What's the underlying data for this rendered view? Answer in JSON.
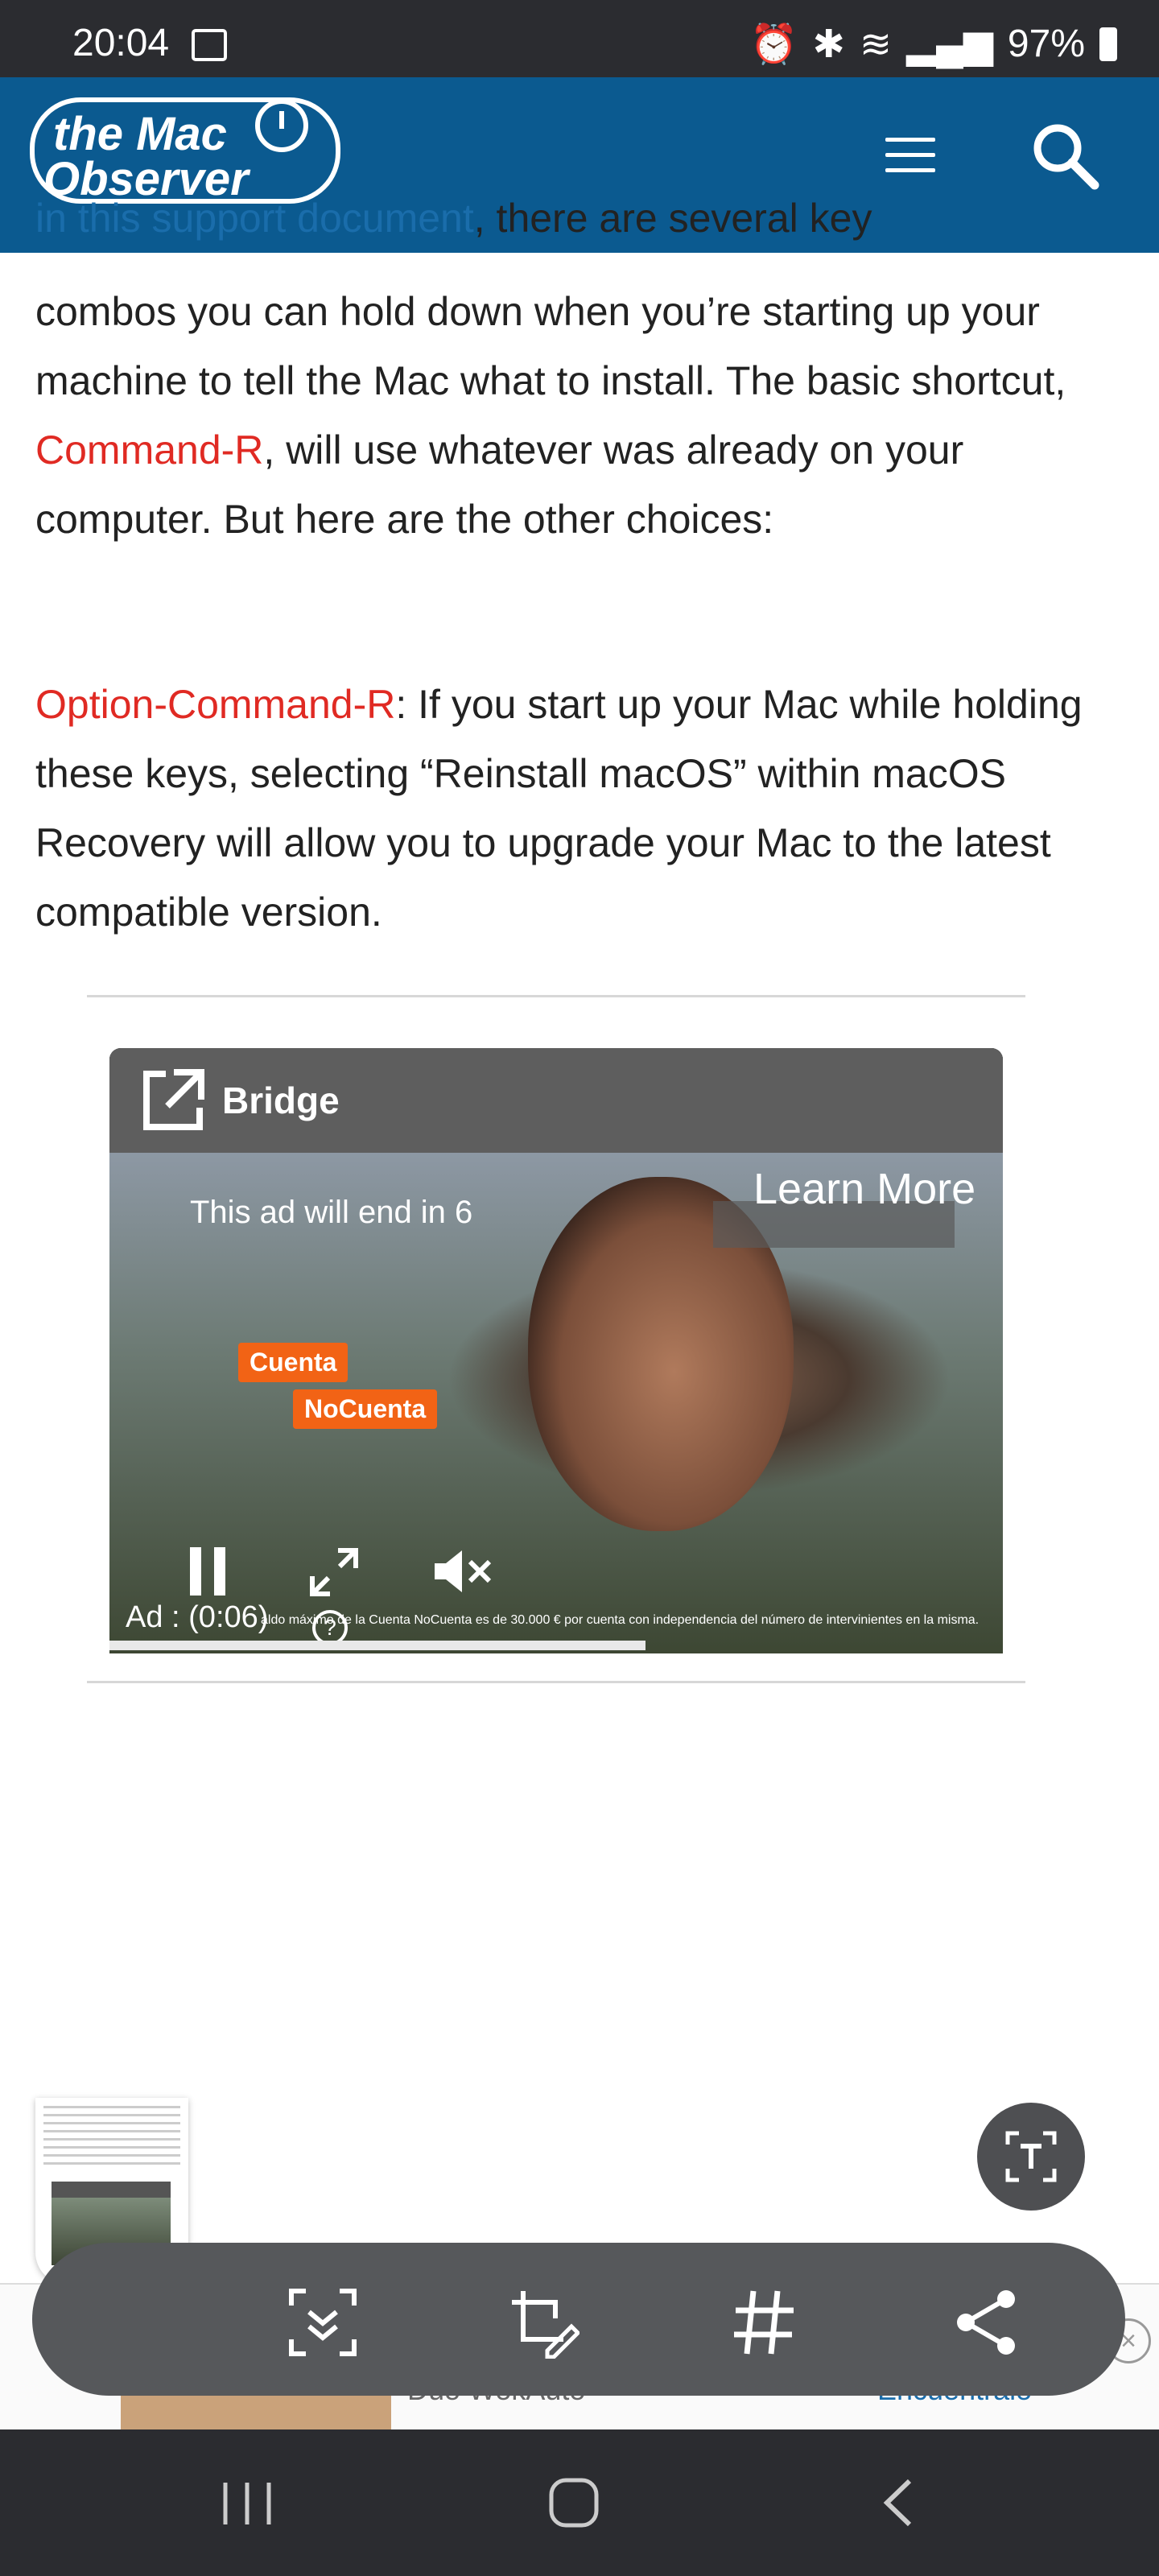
{
  "status_bar": {
    "time": "20:04",
    "battery": "97%"
  },
  "header": {
    "logo_line1": "the Mac",
    "logo_line2": "Observer"
  },
  "article": {
    "cut_line_link": "in this support document",
    "cut_line_text": ", there are several key",
    "p1_a": "combos you can hold down when you’re starting up your machine to tell the Mac what to install. The basic shortcut, ",
    "p1_red": "Command-R",
    "p1_b": ", will use whatever was already on your computer. But here are the other choices:",
    "p2_red": "Option-Command-R",
    "p2_b": ": If you start up your Mac while holding these keys, selecting “Reinstall macOS” within macOS Recovery will allow you to upgrade your Mac to the latest compatible version."
  },
  "ad": {
    "brand": "Bridge",
    "countdown": "This ad will end in 6",
    "learn_more": "Learn More",
    "chip1": "Cuenta",
    "chip2": "NoCuenta",
    "timer": "Ad : (0:06)",
    "disclaimer": "aldo máximo de la Cuenta NoCuenta es de 30.000 € por cuenta con independencia del número de intervinientes en la misma.",
    "progress_fraction": 0.6
  },
  "bottom_ad": {
    "left_text": "Dúo WokAuto",
    "right_text": "Encuéntralo"
  },
  "toolbar": {
    "icons": [
      "scroll-capture-icon",
      "crop-edit-icon",
      "hashtag-icon",
      "share-icon"
    ]
  },
  "colors": {
    "header_bg": "#0b5a90",
    "link_red": "#e02a23",
    "link_blue": "#1a6dab",
    "ad_chip": "#f26315"
  }
}
